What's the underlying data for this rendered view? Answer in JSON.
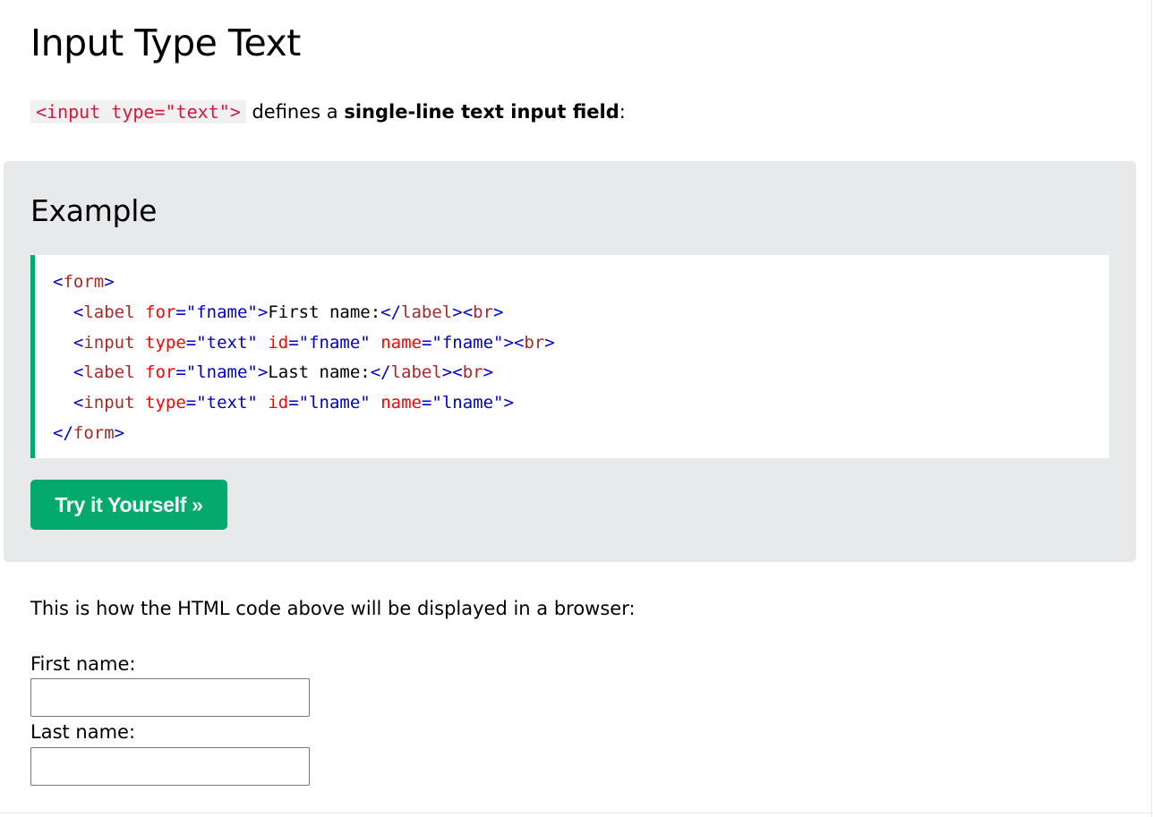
{
  "heading": "Input Type Text",
  "intro": {
    "code": "<input type=\"text\">",
    "before_bold": " defines a ",
    "bold": "single-line text input field",
    "after_bold": ":"
  },
  "example": {
    "title": "Example",
    "code": {
      "l1_open": "<",
      "l1_tag": "form",
      "l1_close": ">",
      "l2_indent": "  ",
      "l2_open": "<",
      "l2_tag": "label",
      "l2_sp": " ",
      "l2_attr": "for",
      "l2_eq": "=",
      "l2_val": "\"fname\"",
      "l2_close": ">",
      "l2_text": "First name:",
      "l2_end_open": "</",
      "l2_end_tag": "label",
      "l2_end_close": ">",
      "l2_br_open": "<",
      "l2_br_tag": "br",
      "l2_br_close": ">",
      "l3_indent": "  ",
      "l3_open": "<",
      "l3_tag": "input",
      "l3_sp1": " ",
      "l3_attr1": "type",
      "l3_eq1": "=",
      "l3_val1": "\"text\"",
      "l3_sp2": " ",
      "l3_attr2": "id",
      "l3_eq2": "=",
      "l3_val2": "\"fname\"",
      "l3_sp3": " ",
      "l3_attr3": "name",
      "l3_eq3": "=",
      "l3_val3": "\"fname\"",
      "l3_close": ">",
      "l3_br_open": "<",
      "l3_br_tag": "br",
      "l3_br_close": ">",
      "l4_indent": "  ",
      "l4_open": "<",
      "l4_tag": "label",
      "l4_sp": " ",
      "l4_attr": "for",
      "l4_eq": "=",
      "l4_val": "\"lname\"",
      "l4_close": ">",
      "l4_text": "Last name:",
      "l4_end_open": "</",
      "l4_end_tag": "label",
      "l4_end_close": ">",
      "l4_br_open": "<",
      "l4_br_tag": "br",
      "l4_br_close": ">",
      "l5_indent": "  ",
      "l5_open": "<",
      "l5_tag": "input",
      "l5_sp1": " ",
      "l5_attr1": "type",
      "l5_eq1": "=",
      "l5_val1": "\"text\"",
      "l5_sp2": " ",
      "l5_attr2": "id",
      "l5_eq2": "=",
      "l5_val2": "\"lname\"",
      "l5_sp3": " ",
      "l5_attr3": "name",
      "l5_eq3": "=",
      "l5_val3": "\"lname\"",
      "l5_close": ">",
      "l6_open": "</",
      "l6_tag": "form",
      "l6_close": ">"
    },
    "try_button": "Try it Yourself »"
  },
  "result": {
    "description": "This is how the HTML code above will be displayed in a browser:",
    "first_label": "First name:",
    "first_value": "",
    "last_label": "Last name:",
    "last_value": ""
  },
  "colors": {
    "accent_green": "#04aa6d",
    "example_bg": "#e7e9eb",
    "code_inline": "#dc143c",
    "tag_name": "#a52a2a",
    "attr_name": "#ff0000",
    "attr_value": "#0000cd"
  }
}
